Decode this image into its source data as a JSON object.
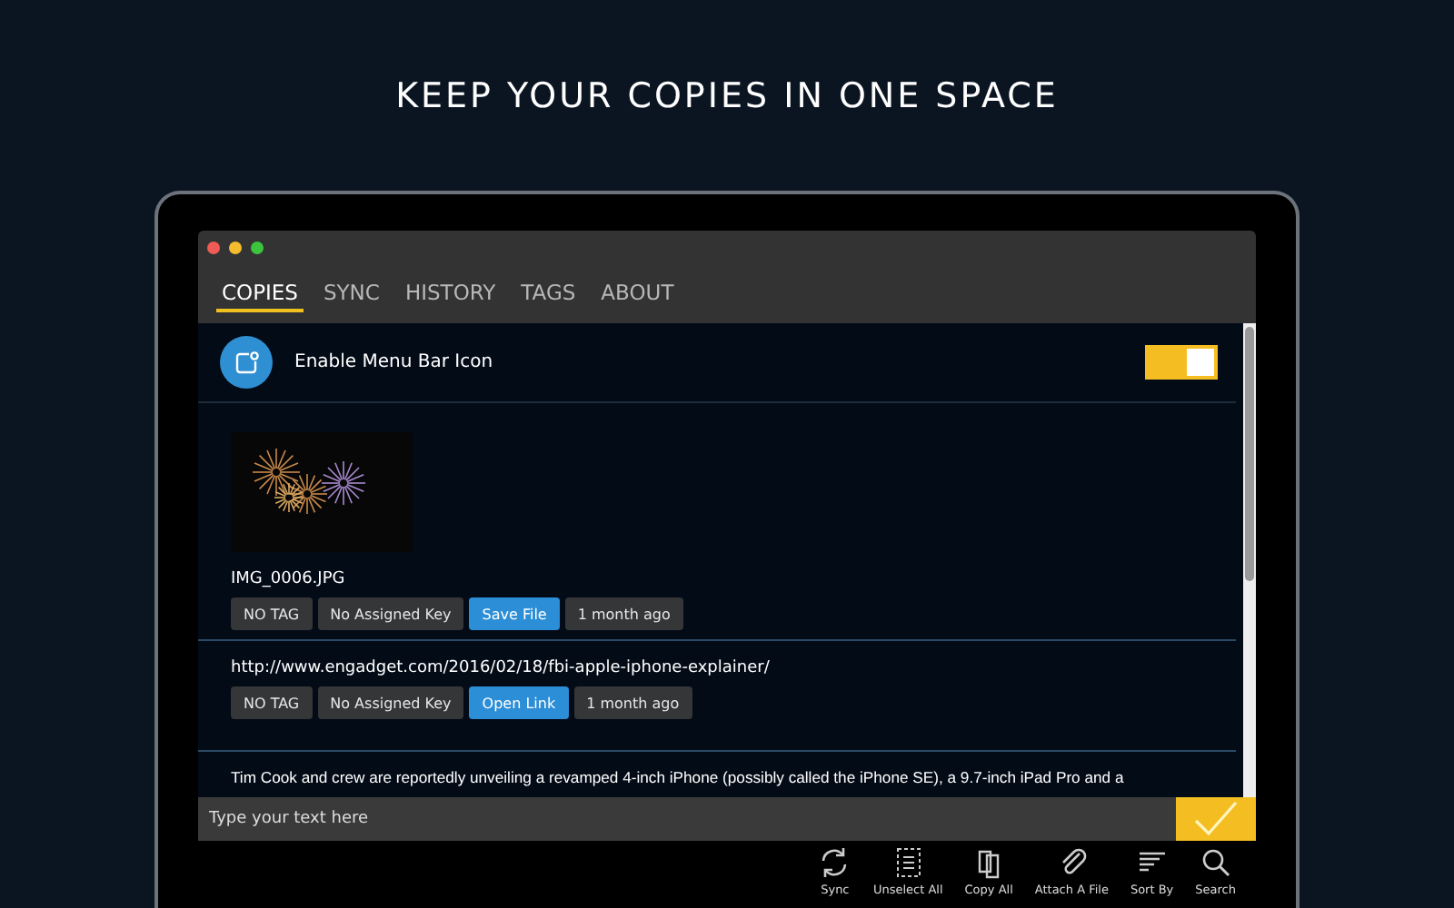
{
  "headline": "KEEP YOUR COPIES IN ONE SPACE",
  "tabs": [
    {
      "label": "COPIES",
      "selected": true
    },
    {
      "label": "SYNC",
      "selected": false
    },
    {
      "label": "HISTORY",
      "selected": false
    },
    {
      "label": "TAGS",
      "selected": false
    },
    {
      "label": "ABOUT",
      "selected": false
    }
  ],
  "setting": {
    "label": "Enable Menu Bar Icon",
    "on": true
  },
  "items": [
    {
      "kind": "image",
      "name": "IMG_0006.JPG",
      "tag": "NO TAG",
      "key": "No Assigned Key",
      "action": "Save File",
      "time": "1 month ago"
    },
    {
      "kind": "link",
      "text": "http://www.engadget.com/2016/02/18/fbi-apple-iphone-explainer/",
      "tag": "NO TAG",
      "key": "No Assigned Key",
      "action": "Open Link",
      "time": "1 month ago"
    },
    {
      "kind": "text",
      "text": "Tim Cook and crew are reportedly unveiling a revamped 4-inch iPhone (possibly called the iPhone SE), a 9.7-inch iPad Pro and a"
    }
  ],
  "input": {
    "placeholder": "Type your text here"
  },
  "toolbar": [
    {
      "kind": "sync",
      "label": "Sync"
    },
    {
      "kind": "unselect",
      "label": "Unselect All"
    },
    {
      "kind": "copy",
      "label": "Copy All"
    },
    {
      "kind": "attach",
      "label": "Attach A File"
    },
    {
      "kind": "sort",
      "label": "Sort By"
    },
    {
      "kind": "search",
      "label": "Search"
    }
  ]
}
